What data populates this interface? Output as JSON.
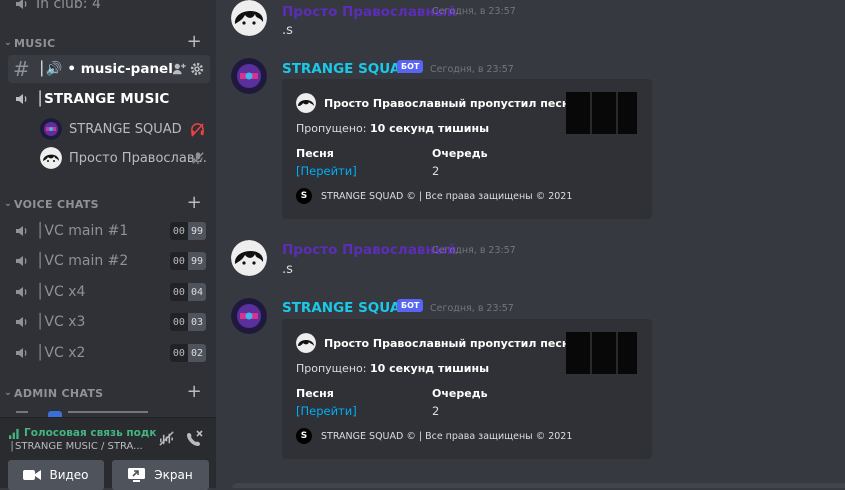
{
  "sidebar": {
    "in_club_label": "In club: 4",
    "music_category": "MUSIC",
    "music_panel_channel": "│🔊 • music-panel",
    "strange_music_channel": "│STRANGE MUSIC",
    "members": [
      {
        "name": "STRANGE SQUAD"
      },
      {
        "name": "Просто Православ..."
      }
    ],
    "voice_category": "VOICE CHATS",
    "voice_channels": [
      {
        "name": "│VC main #1",
        "current": "00",
        "limit": "99"
      },
      {
        "name": "│VC main #2",
        "current": "00",
        "limit": "99"
      },
      {
        "name": "│VC x4",
        "current": "00",
        "limit": "04"
      },
      {
        "name": "│VC x3",
        "current": "00",
        "limit": "03"
      },
      {
        "name": "│VC x2",
        "current": "00",
        "limit": "02"
      }
    ],
    "admin_category": "ADMIN CHATS"
  },
  "voice_panel": {
    "status": "Голосовая связь подк",
    "subtitle": "│STRANGE MUSIC / STRA...",
    "video_label": "Видео",
    "screen_label": "Экран"
  },
  "messages": [
    {
      "author": "Просто Православный",
      "timestamp": "Сегодня, в 23:57",
      "text": ".s",
      "author_color": "#5c2db8"
    },
    {
      "author": "STRANGE SQUAD",
      "badge": "БОТ",
      "timestamp": "Сегодня, в 23:57",
      "author_color": "#1bc8e8",
      "embed": {
        "author": "Просто Православный пропустил песню",
        "desc_prefix": "Пропущено: ",
        "desc_bold": "10 секунд тишины",
        "field1_name": "Песня",
        "field1_value": "[Перейти]",
        "field2_name": "Очередь",
        "field2_value": "2",
        "footer": "STRANGE SQUAD © | Все права защищены © 2021",
        "footer_icon": "S"
      }
    },
    {
      "author": "Просто Православный",
      "timestamp": "Сегодня, в 23:57",
      "text": ".s",
      "author_color": "#5c2db8"
    },
    {
      "author": "STRANGE SQUAD",
      "badge": "БОТ",
      "timestamp": "Сегодня, в 23:57",
      "author_color": "#1bc8e8",
      "embed": {
        "author": "Просто Православный пропустил песню",
        "desc_prefix": "Пропущено: ",
        "desc_bold": "10 секунд тишины",
        "field1_name": "Песня",
        "field1_value": "[Перейти]",
        "field2_name": "Очередь",
        "field2_value": "2",
        "footer": "STRANGE SQUAD © | Все права защищены © 2021",
        "footer_icon": "S"
      }
    }
  ]
}
